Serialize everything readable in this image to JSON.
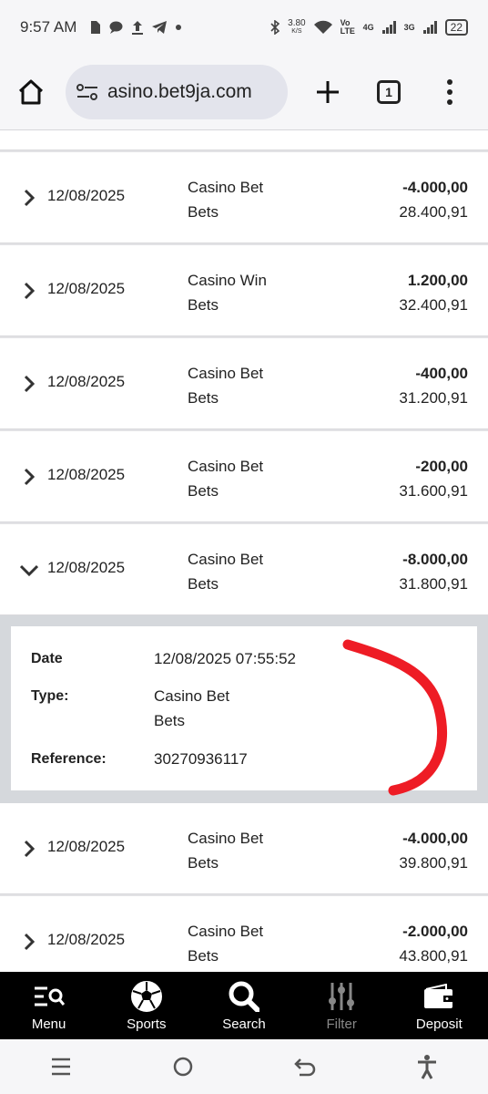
{
  "status": {
    "time": "9:57 AM",
    "net_speed": "3.80",
    "net_unit": "K/S",
    "volte": "Vo LTE",
    "g4": "4G",
    "g3": "3G",
    "battery": "22"
  },
  "browser": {
    "url": "asino.bet9ja.com",
    "tab_count": "1"
  },
  "rows_top": [
    {
      "date": "12/08/2025",
      "type": "Casino Bet",
      "sub": "Bets",
      "amount": "-4.000,00",
      "balance": "28.400,91"
    },
    {
      "date": "12/08/2025",
      "type": "Casino Win",
      "sub": "Bets",
      "amount": "1.200,00",
      "balance": "32.400,91"
    },
    {
      "date": "12/08/2025",
      "type": "Casino Bet",
      "sub": "Bets",
      "amount": "-400,00",
      "balance": "31.200,91"
    },
    {
      "date": "12/08/2025",
      "type": "Casino Bet",
      "sub": "Bets",
      "amount": "-200,00",
      "balance": "31.600,91"
    }
  ],
  "expanded_row": {
    "date": "12/08/2025",
    "type": "Casino Bet",
    "sub": "Bets",
    "amount": "-8.000,00",
    "balance": "31.800,91"
  },
  "details": {
    "date_label": "Date",
    "date_value": "12/08/2025 07:55:52",
    "type_label": "Type:",
    "type_value": "Casino Bet",
    "type_sub": "Bets",
    "ref_label": "Reference:",
    "ref_value": "30270936117",
    "annotation_color": "#ee1c25"
  },
  "rows_bottom": [
    {
      "date": "12/08/2025",
      "type": "Casino Bet",
      "sub": "Bets",
      "amount": "-4.000,00",
      "balance": "39.800,91"
    },
    {
      "date": "12/08/2025",
      "type": "Casino Bet",
      "sub": "Bets",
      "amount": "-2.000,00",
      "balance": "43.800,91"
    }
  ],
  "nav": {
    "menu": "Menu",
    "sports": "Sports",
    "search": "Search",
    "filter": "Filter",
    "deposit": "Deposit"
  }
}
